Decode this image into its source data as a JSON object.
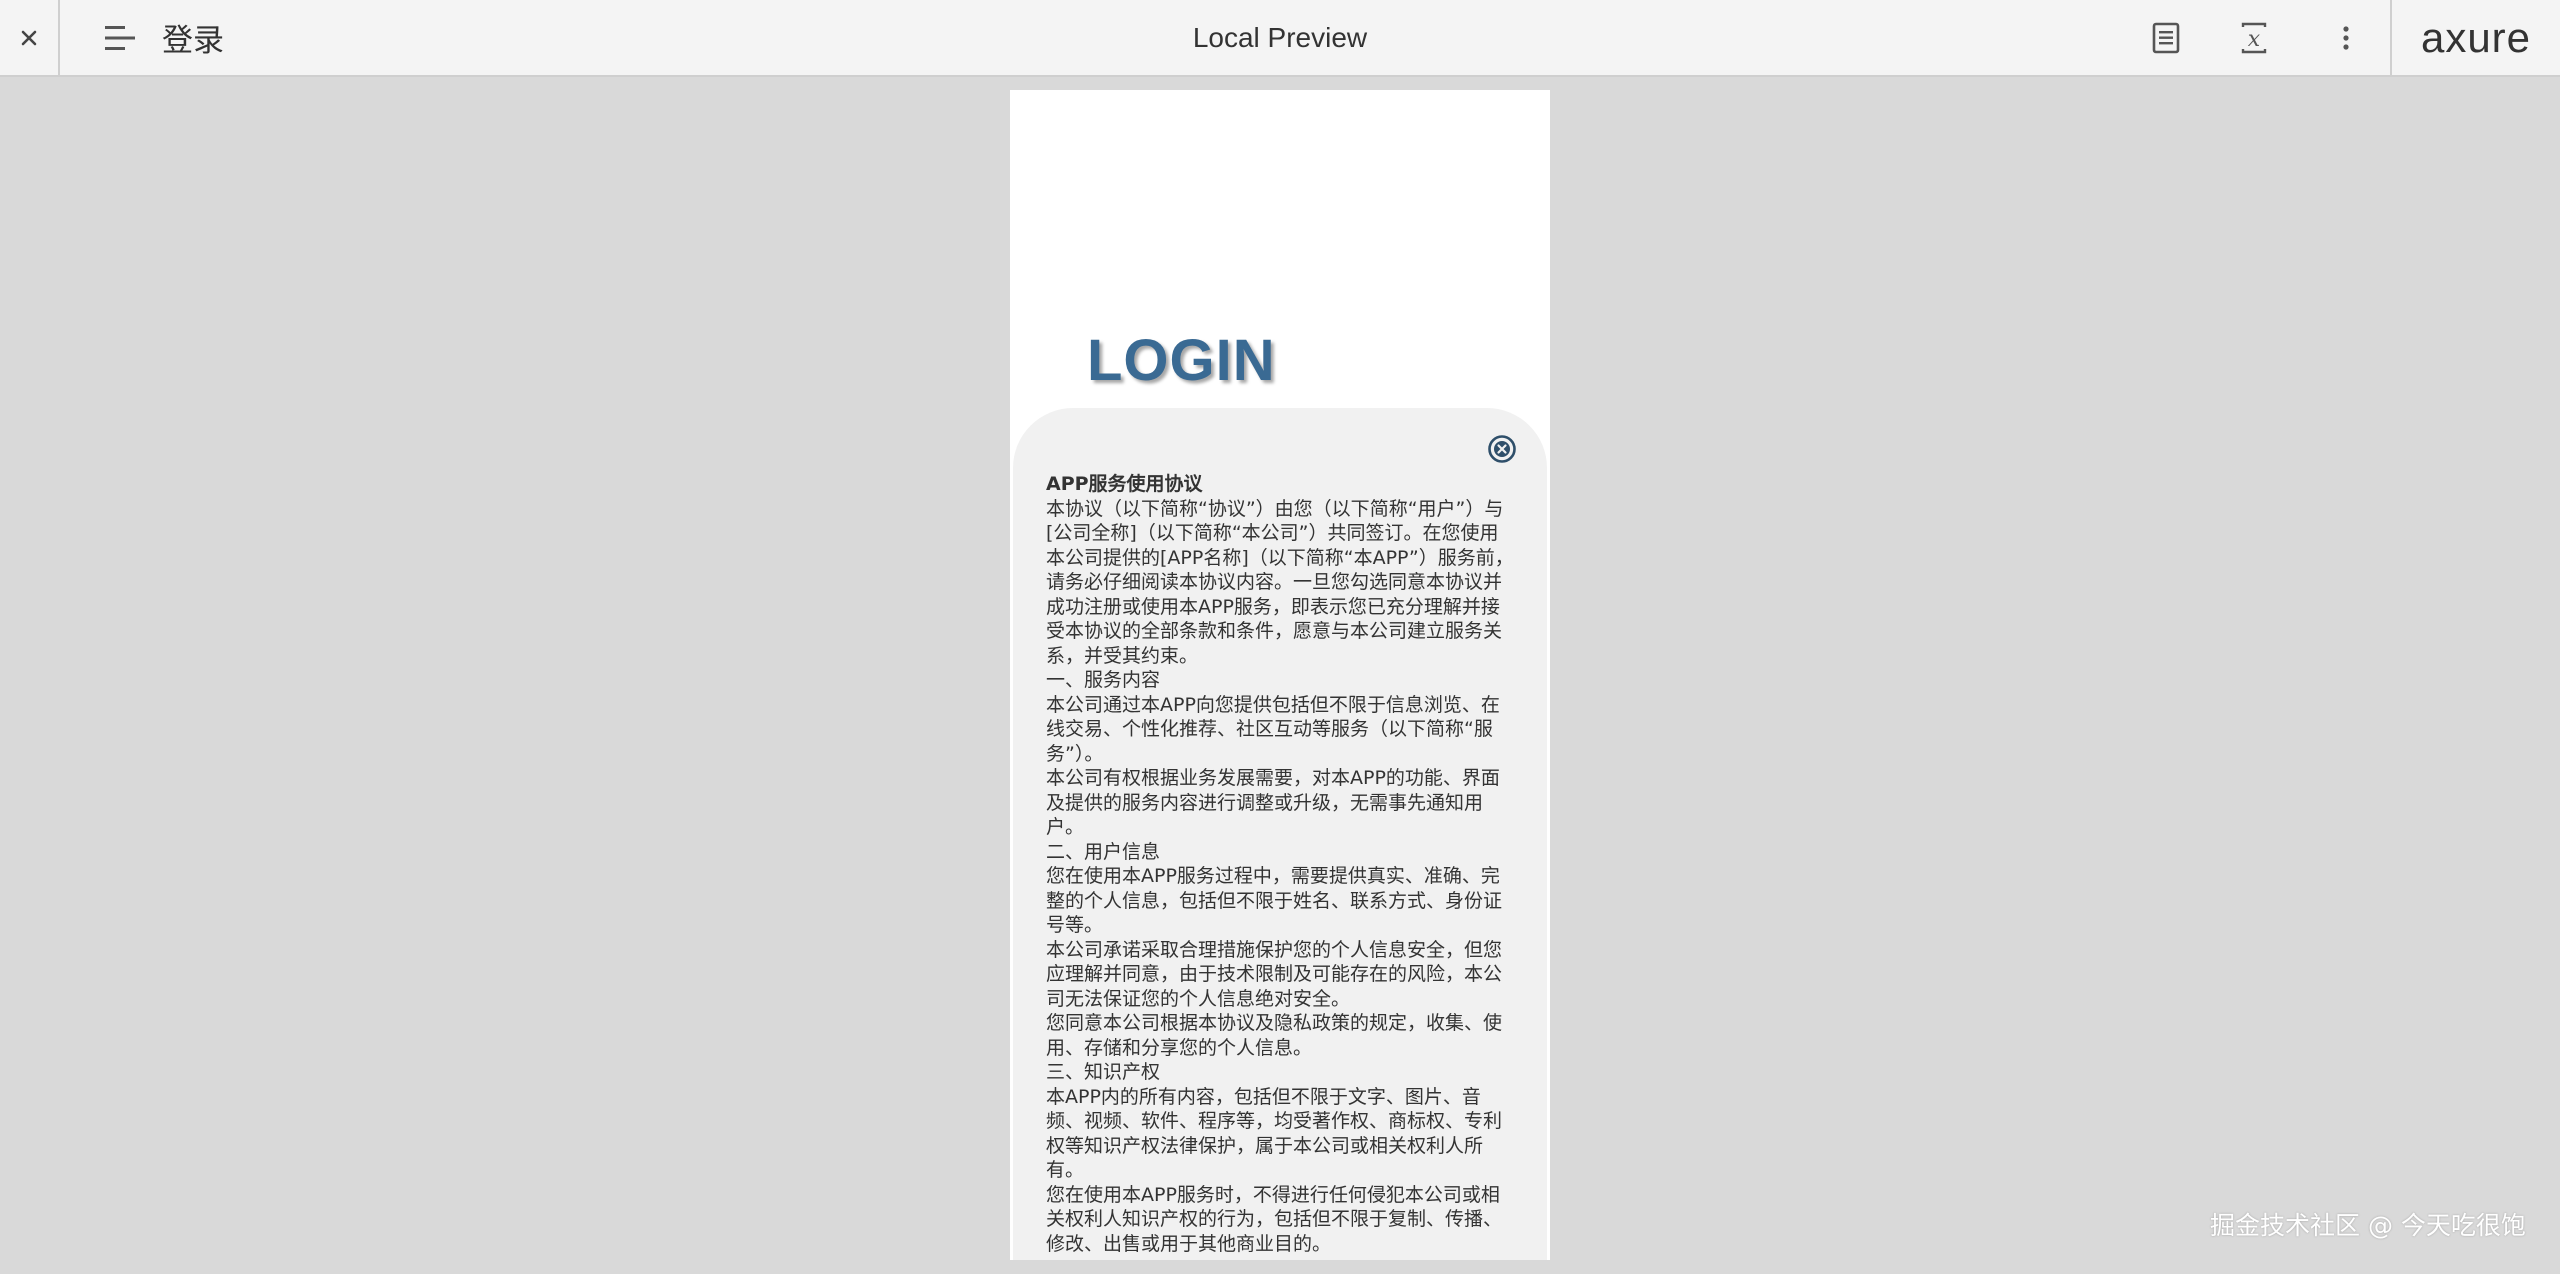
{
  "toolbar": {
    "page_name": "登录",
    "title": "Local Preview",
    "brand": "axure",
    "icons": [
      "close-icon",
      "menu-icon",
      "notes-icon",
      "variable-icon",
      "more-vertical-icon"
    ]
  },
  "screen": {
    "login_title": "LOGIN",
    "agreement": {
      "close_icon": "close-circle-icon",
      "heading": "APP服务使用协议",
      "paragraphs": [
        "本协议（以下简称“协议”）由您（以下简称“用户”）与[公司全称]（以下简称“本公司”）共同签订。在您使用本公司提供的[APP名称]（以下简称“本APP”）服务前，请务必仔细阅读本协议内容。一旦您勾选同意本协议并成功注册或使用本APP服务，即表示您已充分理解并接受本协议的全部条款和条件，愿意与本公司建立服务关系，并受其约束。",
        "一、服务内容",
        "本公司通过本APP向您提供包括但不限于信息浏览、在线交易、个性化推荐、社区互动等服务（以下简称“服务”）。",
        "本公司有权根据业务发展需要，对本APP的功能、界面及提供的服务内容进行调整或升级，无需事先通知用户。",
        "二、用户信息",
        "您在使用本APP服务过程中，需要提供真实、准确、完整的个人信息，包括但不限于姓名、联系方式、身份证号等。",
        "本公司承诺采取合理措施保护您的个人信息安全，但您应理解并同意，由于技术限制及可能存在的风险，本公司无法保证您的个人信息绝对安全。",
        "您同意本公司根据本协议及隐私政策的规定，收集、使用、存储和分享您的个人信息。",
        "三、知识产权",
        "本APP内的所有内容，包括但不限于文字、图片、音频、视频、软件、程序等，均受著作权、商标权、专利权等知识产权法律保护，属于本公司或相关权利人所有。",
        "您在使用本APP服务时，不得进行任何侵犯本公司或相关权利人知识产权的行为，包括但不限于复制、传播、修改、出售或用于其他商业目的。"
      ]
    }
  },
  "watermark": "掘金技术社区 @ 今天吃很饱"
}
